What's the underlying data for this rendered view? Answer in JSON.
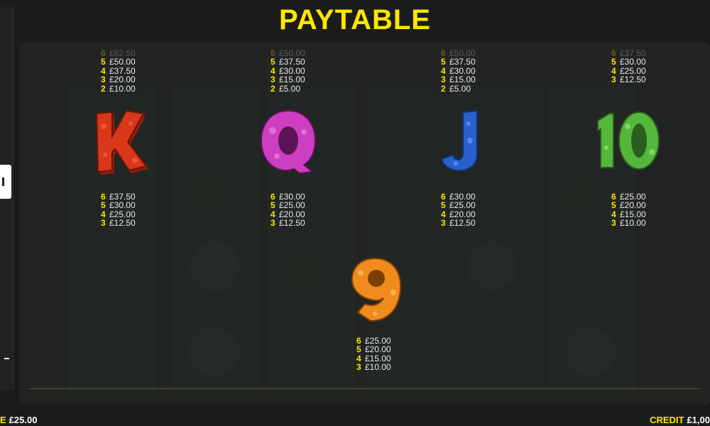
{
  "title": "PAYTABLE",
  "colors": {
    "title": "#ffe600",
    "count": "#ffe600",
    "label": "#ffe600",
    "k": "#d8371a",
    "q": "#cc3fc0",
    "j": "#2860cc",
    "ten": "#55b63c",
    "nine": "#f08a1c"
  },
  "top_tables": [
    {
      "faded": "£62.50",
      "rows": [
        {
          "count": "5",
          "value": "£50.00"
        },
        {
          "count": "4",
          "value": "£37.50"
        },
        {
          "count": "3",
          "value": "£20.00"
        },
        {
          "count": "2",
          "value": "£10.00"
        }
      ]
    },
    {
      "faded": "£50.00",
      "rows": [
        {
          "count": "5",
          "value": "£37.50"
        },
        {
          "count": "4",
          "value": "£30.00"
        },
        {
          "count": "3",
          "value": "£15.00"
        },
        {
          "count": "2",
          "value": "£5.00"
        }
      ]
    },
    {
      "faded": "£50.00",
      "rows": [
        {
          "count": "5",
          "value": "£37.50"
        },
        {
          "count": "4",
          "value": "£30.00"
        },
        {
          "count": "3",
          "value": "£15.00"
        },
        {
          "count": "2",
          "value": "£5.00"
        }
      ]
    },
    {
      "faded": "£37.50",
      "rows": [
        {
          "count": "5",
          "value": "£30.00"
        },
        {
          "count": "4",
          "value": "£25.00"
        },
        {
          "count": "3",
          "value": "£12.50"
        }
      ]
    }
  ],
  "symbols": [
    {
      "name": "K",
      "icon": "k-symbol-icon",
      "rows": [
        {
          "count": "6",
          "value": "£37.50"
        },
        {
          "count": "5",
          "value": "£30.00"
        },
        {
          "count": "4",
          "value": "£25.00"
        },
        {
          "count": "3",
          "value": "£12.50"
        }
      ]
    },
    {
      "name": "Q",
      "icon": "q-symbol-icon",
      "rows": [
        {
          "count": "6",
          "value": "£30.00"
        },
        {
          "count": "5",
          "value": "£25.00"
        },
        {
          "count": "4",
          "value": "£20.00"
        },
        {
          "count": "3",
          "value": "£12.50"
        }
      ]
    },
    {
      "name": "J",
      "icon": "j-symbol-icon",
      "rows": [
        {
          "count": "6",
          "value": "£30.00"
        },
        {
          "count": "5",
          "value": "£25.00"
        },
        {
          "count": "4",
          "value": "£20.00"
        },
        {
          "count": "3",
          "value": "£12.50"
        }
      ]
    },
    {
      "name": "10",
      "icon": "ten-symbol-icon",
      "rows": [
        {
          "count": "6",
          "value": "£25.00"
        },
        {
          "count": "5",
          "value": "£20.00"
        },
        {
          "count": "4",
          "value": "£15.00"
        },
        {
          "count": "3",
          "value": "£10.00"
        }
      ]
    },
    {
      "name": "9",
      "icon": "nine-symbol-icon",
      "rows": [
        {
          "count": "6",
          "value": "£25.00"
        },
        {
          "count": "5",
          "value": "£20.00"
        },
        {
          "count": "4",
          "value": "£15.00"
        },
        {
          "count": "3",
          "value": "£10.00"
        }
      ]
    }
  ],
  "footer": {
    "bet_label": "E",
    "bet_value": "£25.00",
    "credit_label": "CREDIT",
    "credit_value": "£1,00"
  }
}
